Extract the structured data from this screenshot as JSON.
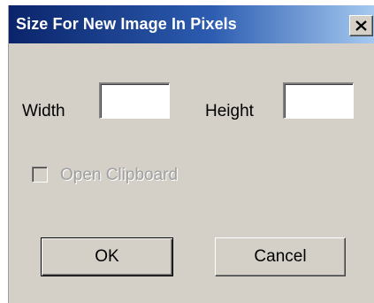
{
  "window": {
    "title": "Size For New Image In Pixels",
    "close_icon": "close-x-icon"
  },
  "form": {
    "width_label": "Width",
    "width_value": "",
    "height_label": "Height",
    "height_value": "",
    "clipboard_label": "Open Clipboard",
    "clipboard_checked": false,
    "clipboard_enabled": false
  },
  "buttons": {
    "ok_label": "OK",
    "cancel_label": "Cancel"
  },
  "colors": {
    "titlebar_start": "#0a246a",
    "titlebar_end": "#a6caf0",
    "dialog_face": "#d4d0c8",
    "disabled_text": "#a0a0a0"
  }
}
